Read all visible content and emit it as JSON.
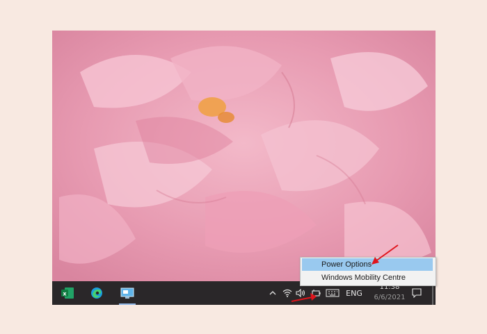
{
  "power_menu": {
    "items": [
      {
        "label": "Power Options"
      },
      {
        "label": "Windows Mobility Centre"
      }
    ]
  },
  "taskbar": {
    "apps": [
      {
        "name": "Excel",
        "icon": "excel-icon"
      },
      {
        "name": "Microsoft Edge",
        "icon": "edge-icon"
      },
      {
        "name": "Remote Desktop",
        "icon": "remote-desktop-icon"
      }
    ],
    "tray": {
      "chevron_icon": "chevron-up-icon",
      "network_icon": "wifi-icon",
      "volume_icon": "speaker-icon",
      "battery_icon": "battery-icon",
      "keyboard_icon": "keyboard-icon",
      "language": "ENG"
    },
    "clock": {
      "time": "11:38",
      "date": "6/6/2021"
    },
    "notification_icon": "notification-icon"
  },
  "colors": {
    "page_background": "#f8e9e1",
    "taskbar": "#2a2729",
    "menu_highlight": "#99c9ef",
    "annotation_arrow": "#e0151c"
  }
}
